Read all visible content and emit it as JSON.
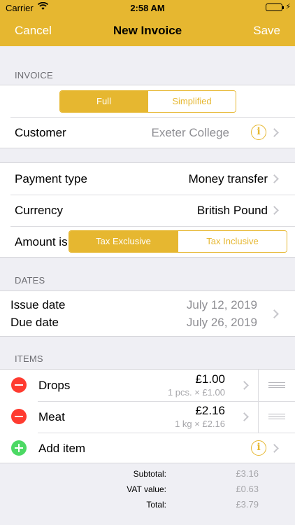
{
  "status": {
    "carrier": "Carrier",
    "time": "2:58 AM"
  },
  "nav": {
    "cancel": "Cancel",
    "title": "New Invoice",
    "save": "Save"
  },
  "invoice_section": {
    "header": "INVOICE",
    "type_options": [
      "Full",
      "Simplified"
    ],
    "selected_type": "Full",
    "customer_label": "Customer",
    "customer_value": "Exeter College"
  },
  "payment_section": {
    "payment_type_label": "Payment type",
    "payment_type_value": "Money transfer",
    "currency_label": "Currency",
    "currency_value": "British Pound",
    "amount_is_label": "Amount is",
    "amount_options": [
      "Tax Exclusive",
      "Tax Inclusive"
    ],
    "selected_amount": "Tax Exclusive"
  },
  "dates_section": {
    "header": "DATES",
    "issue_label": "Issue date",
    "issue_value": "July 12, 2019",
    "due_label": "Due date",
    "due_value": "July 26, 2019"
  },
  "items_section": {
    "header": "ITEMS",
    "items": [
      {
        "name": "Drops",
        "price": "£1.00",
        "detail": "1 pcs. × £1.00"
      },
      {
        "name": "Meat",
        "price": "£2.16",
        "detail": "1 kg × £2.16"
      }
    ],
    "add_label": "Add item"
  },
  "totals": {
    "subtotal_label": "Subtotal:",
    "subtotal_value": "£3.16",
    "vat_label": "VAT value:",
    "vat_value": "£0.63",
    "total_label": "Total:",
    "total_value": "£3.79"
  },
  "colors": {
    "accent": "#e6b730",
    "delete": "#ff3b30",
    "add": "#4cd964",
    "background": "#efeff4"
  }
}
